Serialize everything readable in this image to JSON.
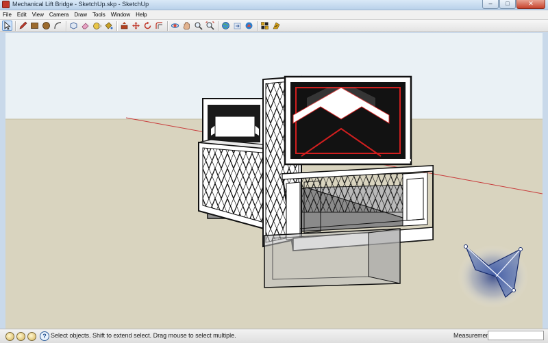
{
  "window": {
    "title": "Mechanical Lift Bridge - SketchUp.skp - SketchUp",
    "minimize_label": "–",
    "maximize_label": "□",
    "close_label": "✕"
  },
  "menubar": {
    "items": [
      {
        "id": "file",
        "label": "File"
      },
      {
        "id": "edit",
        "label": "Edit"
      },
      {
        "id": "view",
        "label": "View"
      },
      {
        "id": "camera",
        "label": "Camera"
      },
      {
        "id": "draw",
        "label": "Draw"
      },
      {
        "id": "tools",
        "label": "Tools"
      },
      {
        "id": "window",
        "label": "Window"
      },
      {
        "id": "help",
        "label": "Help"
      }
    ]
  },
  "toolbar": {
    "tools": [
      {
        "name": "select-tool",
        "icon": "arrow-cursor",
        "active": true,
        "color": "#202020"
      },
      {
        "name": "line-tool",
        "icon": "pencil",
        "color": "#c0392b"
      },
      {
        "name": "rectangle-tool",
        "icon": "rectangle",
        "color": "#9c6b2e"
      },
      {
        "name": "circle-tool",
        "icon": "circle",
        "color": "#9c6b2e"
      },
      {
        "name": "arc-tool",
        "icon": "arc",
        "color": "#555555"
      },
      {
        "name": "make-component-tool",
        "icon": "component",
        "color": "#3b5f9a"
      },
      {
        "name": "eraser-tool",
        "icon": "eraser",
        "color": "#d98bb0"
      },
      {
        "name": "tape-measure-tool",
        "icon": "tape-measure",
        "color": "#c9a227"
      },
      {
        "name": "paint-bucket-tool",
        "icon": "paint-bucket",
        "color": "#b38b1a"
      },
      {
        "name": "push-pull-tool",
        "icon": "push-pull",
        "color": "#b5411f"
      },
      {
        "name": "move-tool",
        "icon": "move",
        "color": "#c0392b"
      },
      {
        "name": "rotate-tool",
        "icon": "rotate",
        "color": "#c0392b"
      },
      {
        "name": "offset-tool",
        "icon": "offset",
        "color": "#c0392b"
      },
      {
        "name": "orbit-tool",
        "icon": "orbit",
        "color": "#2e6db4"
      },
      {
        "name": "pan-tool",
        "icon": "hand",
        "color": "#c98d63"
      },
      {
        "name": "zoom-tool",
        "icon": "magnifier",
        "color": "#444444"
      },
      {
        "name": "zoom-extents-tool",
        "icon": "zoom-extents",
        "color": "#444444"
      },
      {
        "name": "get-models-tool",
        "icon": "globe",
        "color": "#2e7dc9"
      },
      {
        "name": "share-model-tool",
        "icon": "share",
        "color": "#7a9cc6"
      },
      {
        "name": "extension-warehouse-tool",
        "icon": "warehouse",
        "color": "#c0392b"
      },
      {
        "name": "component-browser-tool",
        "icon": "components",
        "color": "#d4a017"
      },
      {
        "name": "layout-tool",
        "icon": "layout",
        "color": "#d4a017"
      }
    ]
  },
  "scene": {
    "sky_color": "#eaf1f5",
    "ground_color": "#d9d4bf",
    "red_axis_color": "#c83a3a",
    "model_white": "#ffffff",
    "model_edge": "#111111",
    "accent_red": "#d11f1f"
  },
  "statusbar": {
    "status_text": "Select objects. Shift to extend select. Drag mouse to select multiple.",
    "help_glyph": "?",
    "measurements_label": "Measurements",
    "measurements_value": ""
  }
}
